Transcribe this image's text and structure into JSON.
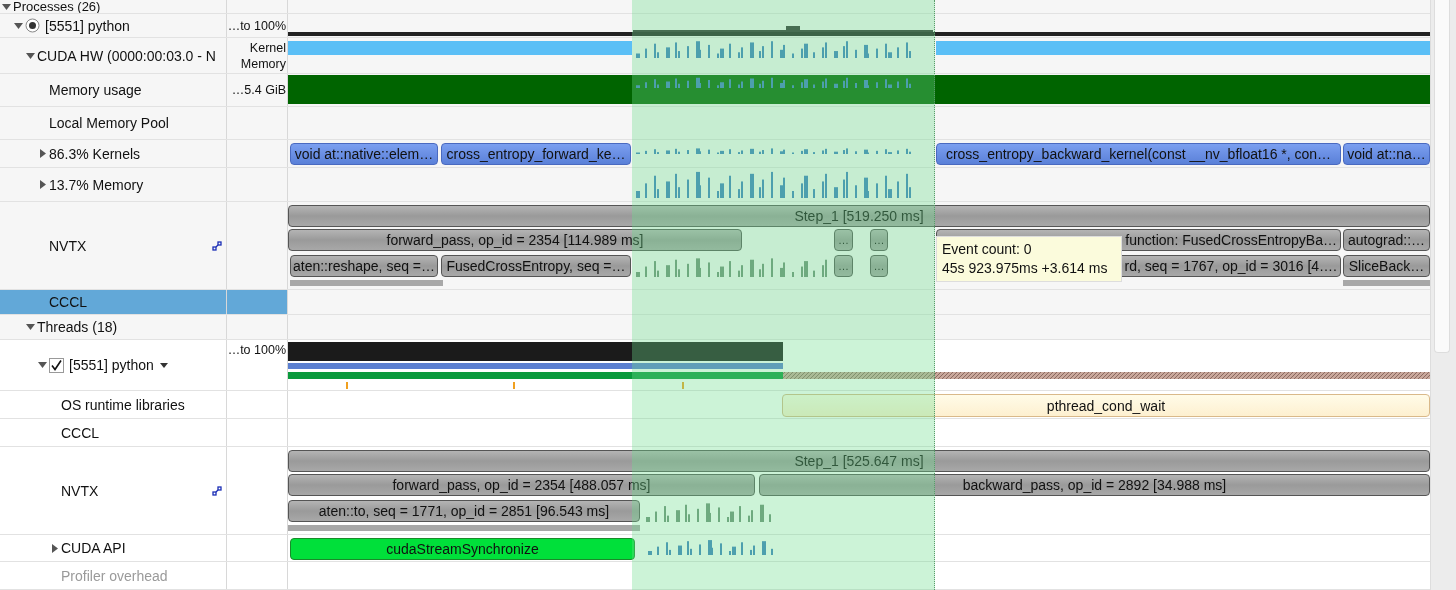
{
  "tree": {
    "label": "Processes (26)",
    "expanded": true,
    "selected": false,
    "children": [
      {
        "label": "[5551] python",
        "expanded": true,
        "selected": false,
        "radio_on": true,
        "value": "…to 100%",
        "kind": "usage",
        "children": [
          {
            "label": "CUDA HW (0000:00:03.0 - N",
            "expanded": true,
            "selected": false,
            "value_lines": [
              "Kernel",
              "Memory"
            ],
            "kind": "hw",
            "children": [
              {
                "label": "Memory usage",
                "selected": false,
                "value": "…5.4 GiB",
                "kind": "memory"
              },
              {
                "label": "Local Memory Pool",
                "selected": false,
                "kind": "empty"
              },
              {
                "label": "86.3% Kernels",
                "expanded": false,
                "selected": false,
                "kind": "kernels",
                "events": [
                  {
                    "label": "void at::native::elem…"
                  },
                  {
                    "label": "cross_entropy_forward_ke…"
                  },
                  {
                    "label": "cross_entropy_backward_kernel(const __nv_bfloat16 *, con…"
                  },
                  {
                    "label": "void at::na…"
                  }
                ]
              },
              {
                "label": "13.7% Memory",
                "expanded": false,
                "selected": false,
                "kind": "sparse"
              },
              {
                "label": "NVTX",
                "selected": false,
                "kind": "nvtx",
                "lanes": [
                  [
                    {
                      "label": "Step_1 [519.250 ms]"
                    }
                  ],
                  [
                    {
                      "label": "forward_pass, op_id = 2354 [114.989 ms]"
                    },
                    {
                      "label": "…"
                    },
                    {
                      "label": "…"
                    },
                    {
                      "label": "function: FusedCrossEntropyBa…"
                    },
                    {
                      "label": "autograd::…"
                    }
                  ],
                  [
                    {
                      "label": "aten::reshape, seq =…"
                    },
                    {
                      "label": "FusedCrossEntropy, seq =…"
                    },
                    {
                      "label": "…"
                    },
                    {
                      "label": "…"
                    },
                    {
                      "label": "rd, seq = 1767, op_id = 3016 [4…."
                    },
                    {
                      "label": "SliceBack…"
                    }
                  ]
                ]
              },
              {
                "label": "CCCL",
                "selected": true,
                "kind": "empty"
              }
            ]
          },
          {
            "label": "Threads (18)",
            "expanded": true,
            "selected": false,
            "children": [
              {
                "label": "[5551] python",
                "expanded": true,
                "selected": false,
                "checked": true,
                "menu": true,
                "value": "…to 100%",
                "kind": "cpu",
                "children": [
                  {
                    "label": "OS runtime libraries",
                    "selected": false,
                    "kind": "osrt",
                    "events": [
                      {
                        "label": "pthread_cond_wait"
                      }
                    ]
                  },
                  {
                    "label": "CCCL",
                    "selected": false,
                    "kind": "empty"
                  },
                  {
                    "label": "NVTX",
                    "selected": false,
                    "kind": "nvtx",
                    "lanes": [
                      [
                        {
                          "label": "Step_1 [525.647 ms]"
                        }
                      ],
                      [
                        {
                          "label": "forward_pass, op_id = 2354 [488.057 ms]"
                        },
                        {
                          "label": "backward_pass, op_id = 2892 [34.988 ms]"
                        }
                      ],
                      [
                        {
                          "label": "aten::to, seq = 1771, op_id = 2851 [96.543 ms]"
                        }
                      ]
                    ]
                  },
                  {
                    "label": "CUDA API",
                    "expanded": false,
                    "selected": false,
                    "kind": "api",
                    "events": [
                      {
                        "label": "cudaStreamSynchronize"
                      }
                    ]
                  },
                  {
                    "label": "Profiler overhead",
                    "selected": false,
                    "disabled": true,
                    "kind": "empty"
                  }
                ]
              }
            ]
          }
        ]
      }
    ]
  },
  "tooltip": {
    "lines": [
      "Event count: 0",
      "45s 923.975ms +3.614 ms"
    ]
  }
}
